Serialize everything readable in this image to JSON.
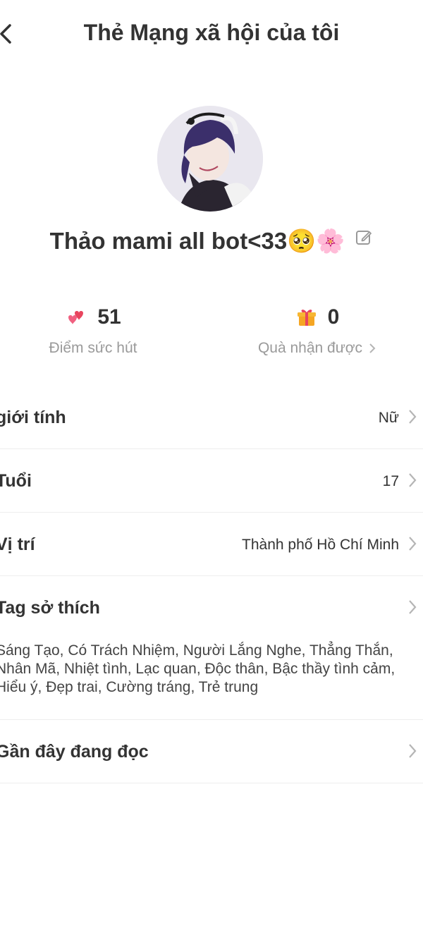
{
  "header": {
    "title": "Thẻ Mạng xã hội của tôi"
  },
  "profile": {
    "name": "Thảo mami all bot<33🥺🌸"
  },
  "stats": {
    "charm": {
      "value": "51",
      "label": "Điểm sức hút"
    },
    "gifts": {
      "value": "0",
      "label": "Quà nhận được"
    }
  },
  "rows": {
    "gender": {
      "label": "giới tính",
      "value": "Nữ"
    },
    "age": {
      "label": "Tuổi",
      "value": "17"
    },
    "location": {
      "label": "Vị trí",
      "value": "Thành phố Hồ Chí Minh"
    },
    "interests": {
      "label": "Tag sở thích",
      "tags_line1": "Sáng Tạo, Có Trách Nhiệm, Người Lắng Nghe, Thẳng Thắn,",
      "tags_line2": "Nhân Mã, Nhiệt tình, Lạc quan, Độc thân, Bậc thầy tình cảm,",
      "tags_line3": "Hiểu ý, Đẹp trai, Cường tráng, Trẻ trung"
    },
    "recent": {
      "label": "Gần đây đang đọc"
    }
  },
  "icons": {
    "back": "chevron-left-icon",
    "edit": "edit-icon",
    "charm": "hearts-icon",
    "gift": "gift-icon",
    "chevron": "chevron-right-icon"
  },
  "colors": {
    "text": "#333333",
    "muted": "#9a9a9a",
    "chevron": "#b5b5b5",
    "divider": "#eeeeee",
    "heart": "#e8455e",
    "gift": "#f5a623"
  }
}
